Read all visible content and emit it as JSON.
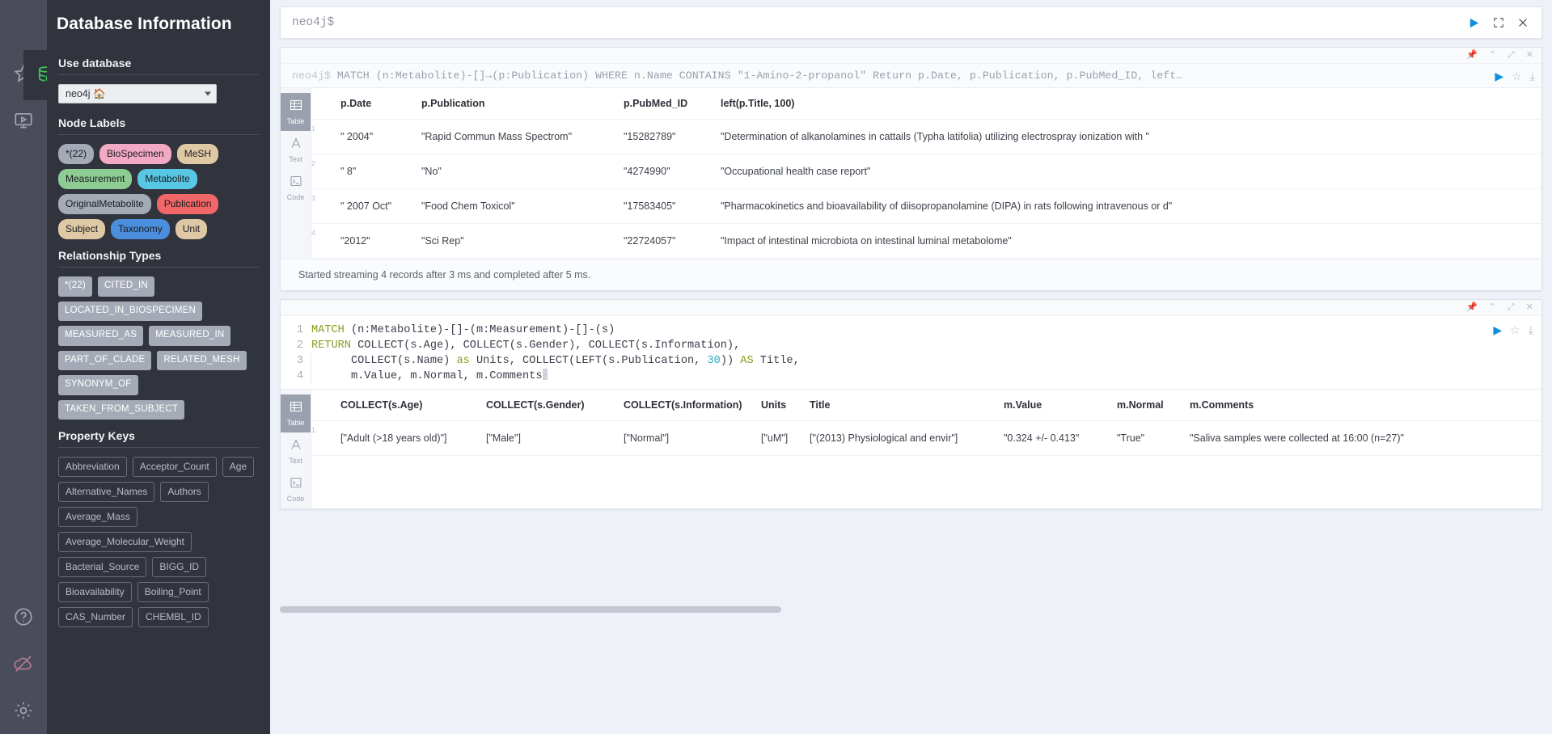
{
  "sidebar": {
    "title": "Database Information",
    "use_database_heading": "Use database",
    "database_value": "neo4j 🏠",
    "node_labels_heading": "Node Labels",
    "node_labels": [
      {
        "label": "*(22)",
        "color": "#a5abb6"
      },
      {
        "label": "BioSpecimen",
        "color": "#f2a9c4"
      },
      {
        "label": "MeSH",
        "color": "#dfc9a5"
      },
      {
        "label": "Measurement",
        "color": "#8dcc93"
      },
      {
        "label": "Metabolite",
        "color": "#57c7e3"
      },
      {
        "label": "OriginalMetabolite",
        "color": "#a5abb6"
      },
      {
        "label": "Publication",
        "color": "#f16667"
      },
      {
        "label": "Subject",
        "color": "#dfc9a5"
      },
      {
        "label": "Taxonomy",
        "color": "#4c8ede"
      },
      {
        "label": "Unit",
        "color": "#dfc9a5"
      }
    ],
    "relationship_types_heading": "Relationship Types",
    "relationship_types": [
      "*(22)",
      "CITED_IN",
      "LOCATED_IN_BIOSPECIMEN",
      "MEASURED_AS",
      "MEASURED_IN",
      "PART_OF_CLADE",
      "RELATED_MESH",
      "SYNONYM_OF",
      "TAKEN_FROM_SUBJECT"
    ],
    "property_keys_heading": "Property Keys",
    "property_keys": [
      "Abbreviation",
      "Acceptor_Count",
      "Age",
      "Alternative_Names",
      "Authors",
      "Average_Mass",
      "Average_Molecular_Weight",
      "Bacterial_Source",
      "BIGG_ID",
      "Bioavailability",
      "Boiling_Point",
      "CAS_Number",
      "CHEMBL_ID"
    ]
  },
  "rail": {
    "items": [
      {
        "name": "database-icon",
        "glyph": "database"
      },
      {
        "name": "favorites-icon",
        "glyph": "star"
      },
      {
        "name": "project-files-icon",
        "glyph": "monitor"
      },
      {
        "name": "help-icon",
        "glyph": "question"
      },
      {
        "name": "connection-status-icon",
        "glyph": "cloud-off"
      },
      {
        "name": "settings-icon",
        "glyph": "gear"
      }
    ]
  },
  "editor": {
    "prompt": "neo4j$",
    "run_label": "▶",
    "expand_label": "⤢",
    "close_label": "✕"
  },
  "frames": [
    {
      "query_prefix": "neo4j$",
      "query": "MATCH (n:Metabolite)-[]→(p:Publication) WHERE n.Name CONTAINS \"1-Amino-2-propanol\" Return p.Date, p.Publication, p.PubMed_ID, left…",
      "views": [
        {
          "label": "Table",
          "icon": "table-icon",
          "active": true
        },
        {
          "label": "Text",
          "icon": "text-icon",
          "active": false
        },
        {
          "label": "Code",
          "icon": "code-icon",
          "active": false
        }
      ],
      "columns": [
        "p.Date",
        "p.Publication",
        "p.PubMed_ID",
        "left(p.Title, 100)"
      ],
      "rows": [
        {
          "num": "1",
          "cells": [
            "\" 2004\"",
            "\"Rapid Commun Mass Spectrom\"",
            "\"15282789\"",
            "\"Determination of alkanolamines in cattails (Typha latifolia) utilizing electrospray ionization with \""
          ]
        },
        {
          "num": "2",
          "cells": [
            "\" 8\"",
            "\"No\"",
            "\"4274990\"",
            "\"Occupational health case report\""
          ]
        },
        {
          "num": "3",
          "cells": [
            "\" 2007 Oct\"",
            "\"Food Chem Toxicol\"",
            "\"17583405\"",
            "\"Pharmacokinetics and bioavailability of diisopropanolamine (DIPA) in rats following intravenous or d\""
          ]
        },
        {
          "num": "4",
          "cells": [
            "\"2012\"",
            "\"Sci Rep\"",
            "\"22724057\"",
            "\"Impact of intestinal microbiota on intestinal luminal metabolome\""
          ]
        }
      ],
      "status": "Started streaming 4 records after 3 ms and completed after 5 ms."
    }
  ],
  "second_frame": {
    "code_lines": [
      {
        "num": "1",
        "segments": [
          {
            "t": "MATCH",
            "c": "kw"
          },
          {
            "t": " (n:Metabolite)-[]-(m:Measurement)-[]-(s)",
            "c": ""
          }
        ]
      },
      {
        "num": "2",
        "segments": [
          {
            "t": "RETURN",
            "c": "kw"
          },
          {
            "t": " COLLECT(s.Age), COLLECT(s.Gender), COLLECT(s.Information),",
            "c": ""
          }
        ]
      },
      {
        "num": "3",
        "segments": [
          {
            "t": "      COLLECT(s.Name) ",
            "c": ""
          },
          {
            "t": "as",
            "c": "kw"
          },
          {
            "t": " Units, COLLECT(LEFT(s.Publication, ",
            "c": ""
          },
          {
            "t": "30",
            "c": "num"
          },
          {
            "t": ")) ",
            "c": ""
          },
          {
            "t": "AS",
            "c": "kw"
          },
          {
            "t": " Title,",
            "c": ""
          }
        ]
      },
      {
        "num": "4",
        "segments": [
          {
            "t": "      m.Value, m.Normal, m.Comments",
            "c": ""
          }
        ]
      }
    ],
    "views": [
      {
        "label": "Table",
        "icon": "table-icon",
        "active": true
      },
      {
        "label": "Text",
        "icon": "text-icon",
        "active": false
      },
      {
        "label": "Code",
        "icon": "code-icon",
        "active": false
      }
    ],
    "columns": [
      "COLLECT(s.Age)",
      "COLLECT(s.Gender)",
      "COLLECT(s.Information)",
      "Units",
      "Title",
      "m.Value",
      "m.Normal",
      "m.Comments"
    ],
    "rows": [
      {
        "num": "1",
        "cells": [
          "[\"Adult (>18 years old)\"]",
          "[\"Male\"]",
          "[\"Normal\"]",
          "[\"uM\"]",
          "[\"(2013) Physiological and envir\"]",
          "\"0.324 +/- 0.413\"",
          "\"True\"",
          "\"Saliva samples were collected at 16:00 (n=27)\""
        ]
      }
    ]
  },
  "colors": {
    "accent_blue": "#0f8fe0",
    "sidebar_bg": "#31333d",
    "rail_bg": "#4a4c5a",
    "main_bg": "#eef1f8",
    "keyword": "#8a9b1f",
    "number": "#2aa7c4"
  }
}
